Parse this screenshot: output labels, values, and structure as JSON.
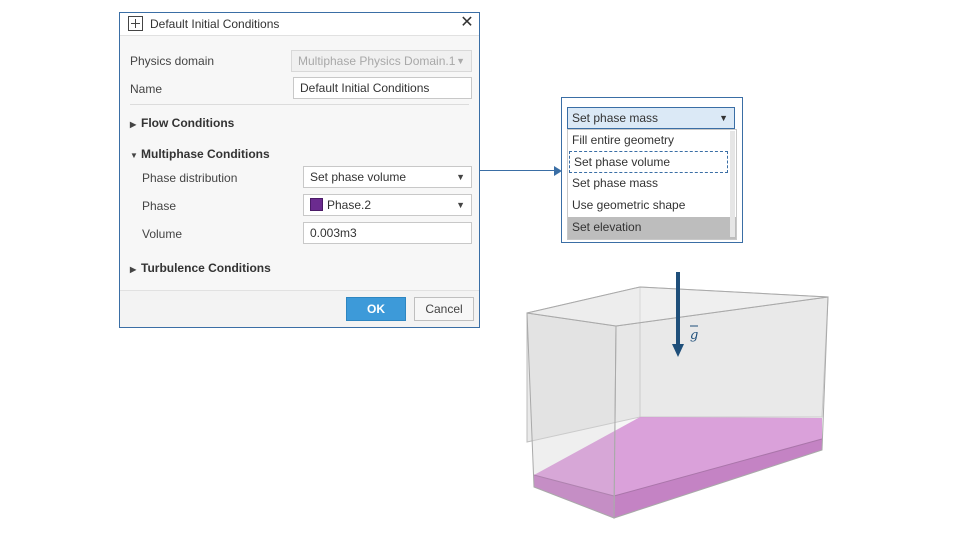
{
  "dialog": {
    "title": "Default Initial Conditions",
    "fields": {
      "physics_domain_label": "Physics domain",
      "physics_domain_value": "Multiphase Physics Domain.1",
      "name_label": "Name",
      "name_value": "Default Initial Conditions"
    },
    "sections": {
      "flow": "Flow Conditions",
      "multiphase": "Multiphase Conditions",
      "turbulence": "Turbulence Conditions"
    },
    "multiphase": {
      "distribution_label": "Phase distribution",
      "distribution_value": "Set phase volume",
      "phase_label": "Phase",
      "phase_value": "Phase.2",
      "phase_color": "#6b2b8f",
      "volume_label": "Volume",
      "volume_value": "0.003m3"
    },
    "buttons": {
      "ok": "OK",
      "cancel": "Cancel"
    }
  },
  "popup": {
    "selected": "Set phase mass",
    "options": [
      "Fill entire geometry",
      "Set phase volume",
      "Set phase mass",
      "Use geometric shape",
      "Set elevation"
    ]
  },
  "box": {
    "gravity_label": "g",
    "fill_color": "#cc66cc",
    "arrow_color": "#1f4f7a"
  },
  "icons": [
    "app-icon",
    "close-icon",
    "chevron-down-icon",
    "triangle-right-icon",
    "triangle-down-icon",
    "arrow-right-icon",
    "arrow-down-icon"
  ]
}
